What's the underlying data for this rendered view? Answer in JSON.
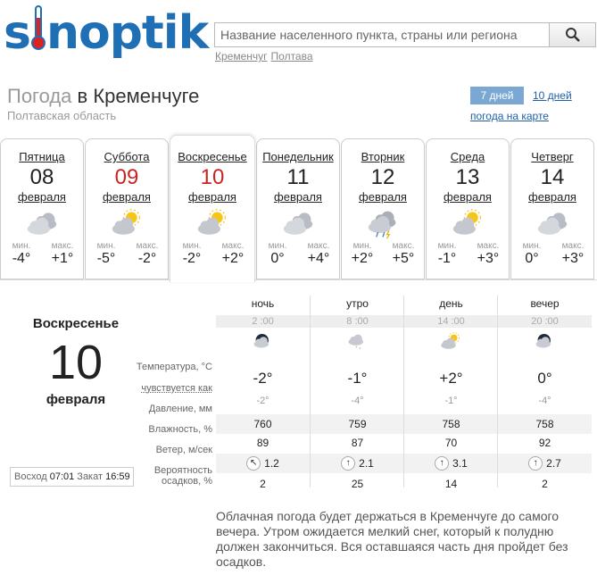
{
  "header": {
    "logo_pre": "s",
    "logo_post": "noptik",
    "search_placeholder": "Название населенного пункта, страны или региона",
    "recent_searches": [
      "Кременчуг",
      "Полтава"
    ]
  },
  "location": {
    "prefix": "Погода",
    "city": "в Кременчуге",
    "region": "Полтавская область"
  },
  "nav": {
    "tab_7days": "7 дней",
    "tab_10days": "10 дней",
    "map_link": "погода на карте"
  },
  "days": [
    {
      "name": "Пятница",
      "num": "08",
      "month": "февраля",
      "min_label": "мин.",
      "max_label": "макс.",
      "min": "-4°",
      "max": "+1°",
      "icon": "cloudy-icon",
      "red": false
    },
    {
      "name": "Суббота",
      "num": "09",
      "month": "февраля",
      "min_label": "мин.",
      "max_label": "макс.",
      "min": "-5°",
      "max": "-2°",
      "icon": "partly-cloudy-icon",
      "red": true
    },
    {
      "name": "Воскресенье",
      "num": "10",
      "month": "февраля",
      "min_label": "мин.",
      "max_label": "макс.",
      "min": "-2°",
      "max": "+2°",
      "icon": "partly-cloudy-icon",
      "red": true
    },
    {
      "name": "Понедельник",
      "num": "11",
      "month": "февраля",
      "min_label": "мин.",
      "max_label": "макс.",
      "min": "0°",
      "max": "+4°",
      "icon": "cloudy-icon",
      "red": false
    },
    {
      "name": "Вторник",
      "num": "12",
      "month": "февраля",
      "min_label": "мин.",
      "max_label": "макс.",
      "min": "+2°",
      "max": "+5°",
      "icon": "rain-icon",
      "red": false
    },
    {
      "name": "Среда",
      "num": "13",
      "month": "февраля",
      "min_label": "мин.",
      "max_label": "макс.",
      "min": "-1°",
      "max": "+3°",
      "icon": "partly-cloudy-icon",
      "red": false
    },
    {
      "name": "Четверг",
      "num": "14",
      "month": "февраля",
      "min_label": "мин.",
      "max_label": "макс.",
      "min": "0°",
      "max": "+3°",
      "icon": "cloudy-icon",
      "red": false
    }
  ],
  "selected": {
    "name": "Воскресенье",
    "num": "10",
    "month": "февраля"
  },
  "sun": {
    "rise_label": "Восход",
    "rise": "07:01",
    "set_label": "Закат",
    "set": "16:59"
  },
  "row_labels": {
    "temp": "Температура, °C",
    "feel": "чувствуется как",
    "press": "Давление, мм",
    "hum": "Влажность, %",
    "wind": "Ветер, м/сек",
    "prob_1": "Вероятность",
    "prob_2": "осадков, %"
  },
  "periods": [
    {
      "name": "ночь",
      "time": "2 :00",
      "icon": "night-cloudy-icon",
      "temp": "-2°",
      "feel": "-2°",
      "press": "760",
      "hum": "89",
      "wind_dir": "↖",
      "wind": "1.2",
      "prob": "2"
    },
    {
      "name": "утро",
      "time": "8 :00",
      "icon": "snow-icon",
      "temp": "-1°",
      "feel": "-4°",
      "press": "759",
      "hum": "87",
      "wind_dir": "↑",
      "wind": "2.1",
      "prob": "25"
    },
    {
      "name": "день",
      "time": "14 :00",
      "icon": "sun-cloud-icon",
      "temp": "+2°",
      "feel": "-1°",
      "press": "758",
      "hum": "70",
      "wind_dir": "↑",
      "wind": "3.1",
      "prob": "14"
    },
    {
      "name": "вечер",
      "time": "20 :00",
      "icon": "night-cloudy-icon",
      "temp": "0°",
      "feel": "-4°",
      "press": "758",
      "hum": "92",
      "wind_dir": "↑",
      "wind": "2.7",
      "prob": "2"
    }
  ],
  "description": "Облачная погода будет держаться в Кременчуге до самого вечера. Утром ожидается мелкий снег, который к полудню должен закончиться. Вся оставшаяся часть дня пройдет без осадков.",
  "colors": {
    "brand": "#1f6fb5",
    "accent_red": "#c22222",
    "tab_active": "#7aa8d3"
  }
}
